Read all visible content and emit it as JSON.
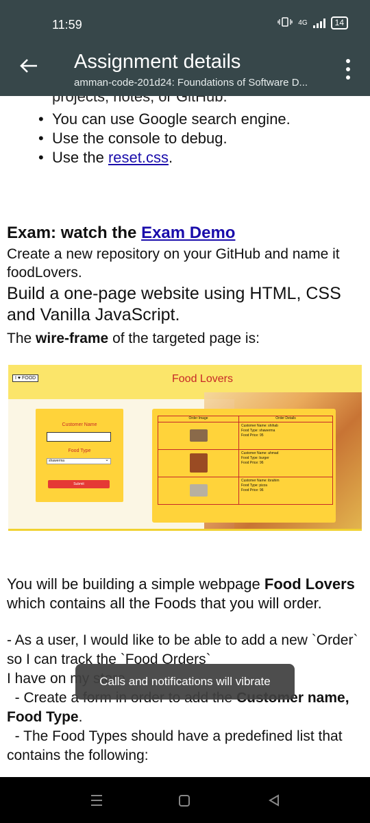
{
  "status_bar": {
    "time": "11:59",
    "network": "4G",
    "battery": "14"
  },
  "app_bar": {
    "title": "Assignment details",
    "subtitle": "amman-code-201d24: Foundations of Software D..."
  },
  "content": {
    "cut_line": "projects, notes, or GitHub.",
    "bullets": [
      {
        "text": "You can use Google search engine."
      },
      {
        "text": "Use the console to debug."
      },
      {
        "prefix": "Use the ",
        "link": "reset.css",
        "suffix": "."
      }
    ],
    "exam_heading": "Exam: watch the ",
    "exam_link": "Exam Demo",
    "p1": "Create a new repository on your GitHub and name it foodLovers.",
    "p2": "Build a one-page website using HTML, CSS and Vanilla JavaScript.",
    "p3_pre": "The ",
    "p3_bold": "wire-frame",
    "p3_post": " of the targeted page is:",
    "p4_pre": "You will be building a simple webpage ",
    "p4_bold": "Food Lovers",
    "p4_post": " which contains all the Foods that you will order.",
    "p5": "- As a user, I would like to be able to add a new `Order` so I can track the `Food Orders`",
    "p6": "I have on my store",
    "p7_pre": "  - Create a form in order to add the ",
    "p7_bold": "Customer name, Food Type",
    "p7_post": ".",
    "p8": "  - The Food Types should have a predefined list that contains the following:"
  },
  "wireframe": {
    "logo": "I ♥ FOOD",
    "title": "Food Lovers",
    "form": {
      "customer_label": "Customer Name",
      "food_type_label": "Food Type",
      "select_value": "shawerma",
      "submit": "Submit"
    },
    "table": {
      "headers": [
        "Order Image",
        "Order Details"
      ],
      "rows": [
        {
          "name": "Customer Name: shihab",
          "type": "Food Type: shawerma",
          "price": "Food Price: 95",
          "thumb_color": "#8a6a4a"
        },
        {
          "name": "Customer Name: ahmad",
          "type": "Food Type: burger",
          "price": "Food Price: 96",
          "thumb_color": "#9a4b23"
        },
        {
          "name": "Customer Name: ibrahim",
          "type": "Food Type: pizza",
          "price": "Food Price: 96",
          "thumb_color": "#b8b0a0"
        }
      ]
    }
  },
  "toast": "Calls and notifications will vibrate"
}
